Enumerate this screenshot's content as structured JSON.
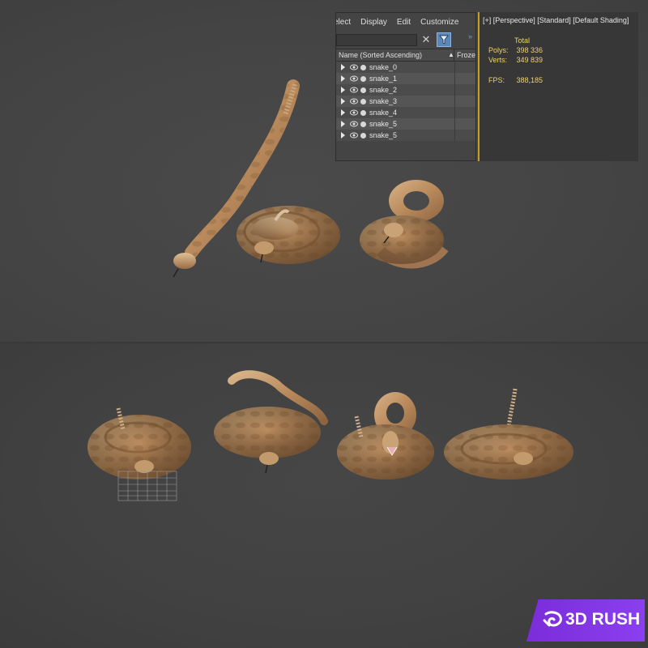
{
  "scene_explorer": {
    "menu": [
      "elect",
      "Display",
      "Edit",
      "Customize"
    ],
    "search_value": "",
    "column_name": "Name (Sorted Ascending)",
    "column_frozen": "Froze",
    "expand_glyph": "»",
    "rows": [
      {
        "name": "snake_0"
      },
      {
        "name": "snake_1"
      },
      {
        "name": "snake_2"
      },
      {
        "name": "snake_3"
      },
      {
        "name": "snake_4"
      },
      {
        "name": "snake_5"
      },
      {
        "name": "snake_5"
      }
    ]
  },
  "viewport": {
    "label": "[+] [Perspective] [Standard] [Default Shading]",
    "stats_header": "Total",
    "polys_label": "Polys:",
    "polys_value": "398 336",
    "verts_label": "Verts:",
    "verts_value": "349 839",
    "fps_label": "FPS:",
    "fps_value": "388,185"
  },
  "brand": {
    "text": "3D RUSH",
    "logo_icon": "rush-swirl-icon"
  },
  "colors": {
    "accent_purple": "#8a3ff0",
    "stats_yellow": "#f0d070",
    "highlight_border": "#c8a020",
    "filter_blue": "#5a86b8"
  }
}
